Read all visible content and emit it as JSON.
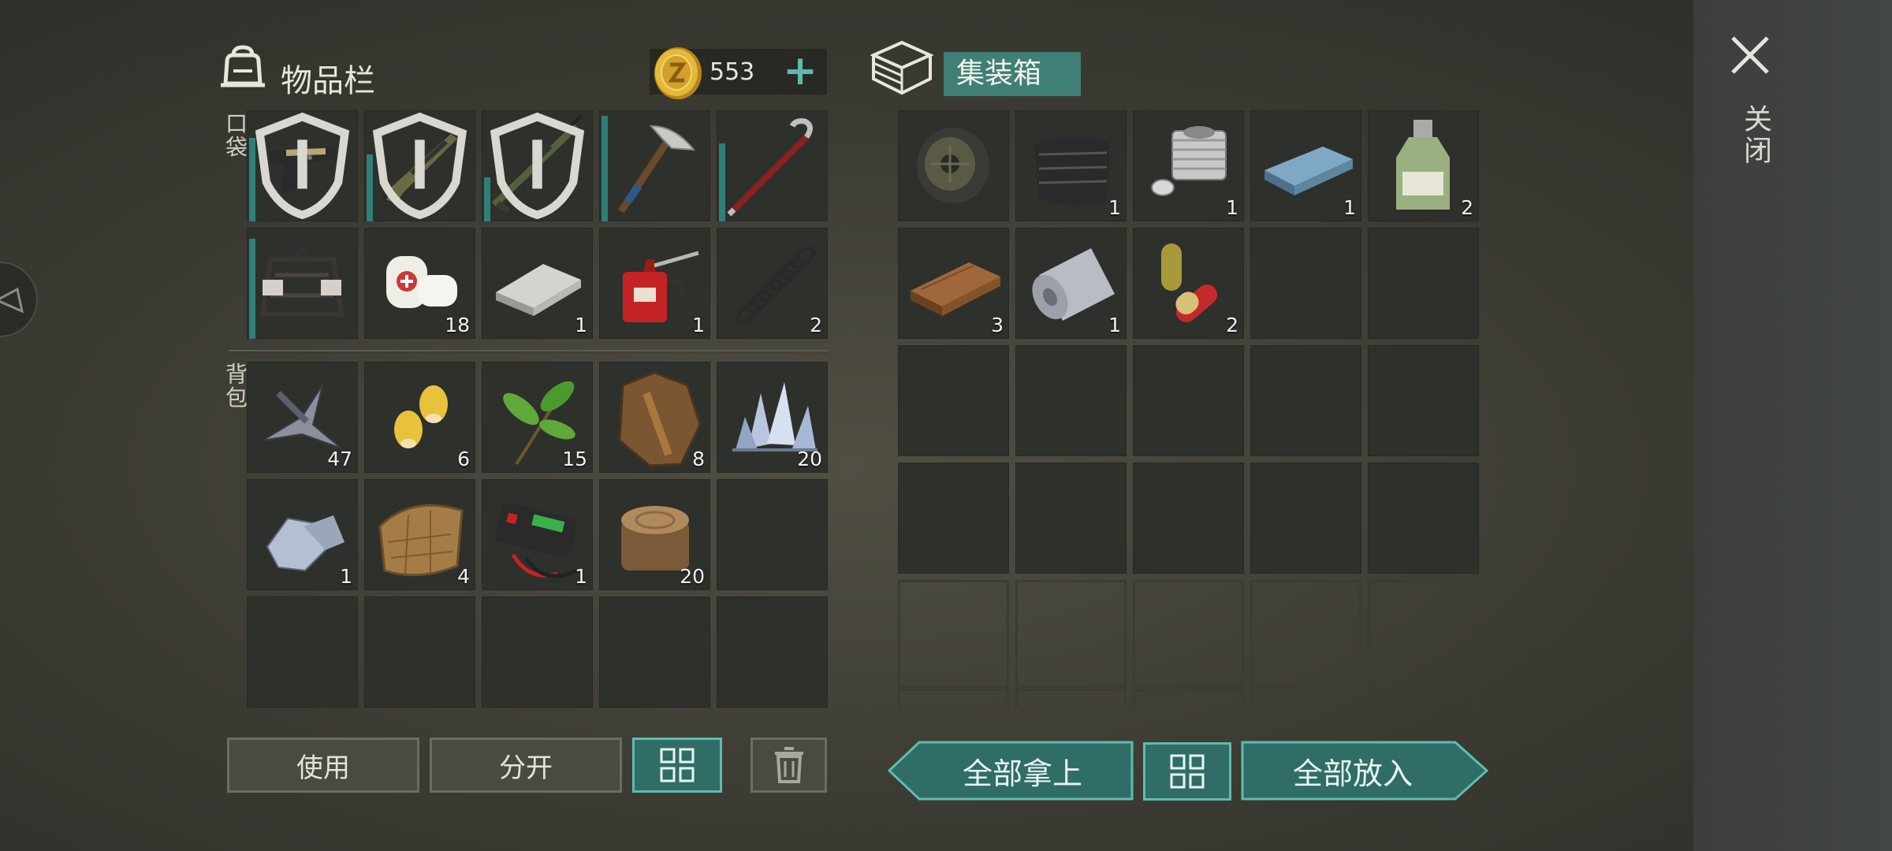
{
  "inventory": {
    "title": "物品栏",
    "coins": "553",
    "add_coins_label": "+",
    "pocket_label": "口袋",
    "backpack_label": "背包",
    "pockets": [
      {
        "item": "pistol",
        "qty": "",
        "durability": 0.75,
        "shield": true
      },
      {
        "item": "shotgun",
        "qty": "",
        "durability": 0.6,
        "shield": true
      },
      {
        "item": "sniper-rifle",
        "qty": "",
        "durability": 0.4,
        "shield": true
      },
      {
        "item": "pickaxe",
        "qty": "",
        "durability": 0.95,
        "shield": false
      },
      {
        "item": "crowbar",
        "qty": "",
        "durability": 0.7,
        "shield": false
      },
      {
        "item": "barbed-armor",
        "qty": "",
        "durability": 0.9,
        "shield": false
      },
      {
        "item": "bandage",
        "qty": "18"
      },
      {
        "item": "metal-bar",
        "qty": "1"
      },
      {
        "item": "oil-can",
        "qty": "1"
      },
      {
        "item": "spring",
        "qty": "2"
      }
    ],
    "backpack": [
      {
        "item": "scrap-metal",
        "qty": "47"
      },
      {
        "item": "corn-seeds",
        "qty": "6"
      },
      {
        "item": "plant-fiber",
        "qty": "15"
      },
      {
        "item": "animal-hide",
        "qty": "8"
      },
      {
        "item": "crystal",
        "qty": "20"
      },
      {
        "item": "iron-ore",
        "qty": "1"
      },
      {
        "item": "leather",
        "qty": "4"
      },
      {
        "item": "battery-charger",
        "qty": "1"
      },
      {
        "item": "log",
        "qty": "20"
      },
      {
        "item": "",
        "qty": ""
      },
      {
        "item": "",
        "qty": ""
      },
      {
        "item": "",
        "qty": ""
      },
      {
        "item": "",
        "qty": ""
      },
      {
        "item": "",
        "qty": ""
      },
      {
        "item": "",
        "qty": ""
      }
    ],
    "buttons": {
      "use": "使用",
      "split": "分开",
      "sort_icon": "grid-icon",
      "trash_icon": "trash-icon"
    }
  },
  "container": {
    "title": "集装箱",
    "items": [
      {
        "item": "wheel",
        "qty": ""
      },
      {
        "item": "carbon-fabric",
        "qty": "1"
      },
      {
        "item": "engine-cylinder",
        "qty": "1"
      },
      {
        "item": "steel-ingot",
        "qty": "1"
      },
      {
        "item": "chemical-bottle",
        "qty": "2"
      },
      {
        "item": "wood-plank",
        "qty": "3"
      },
      {
        "item": "fabric-roll",
        "qty": "1"
      },
      {
        "item": "pills",
        "qty": "2"
      },
      {
        "item": "",
        "qty": ""
      },
      {
        "item": "",
        "qty": ""
      },
      {
        "item": "",
        "qty": ""
      },
      {
        "item": "",
        "qty": ""
      },
      {
        "item": "",
        "qty": ""
      },
      {
        "item": "",
        "qty": ""
      },
      {
        "item": "",
        "qty": ""
      },
      {
        "item": "",
        "qty": ""
      },
      {
        "item": "",
        "qty": ""
      },
      {
        "item": "",
        "qty": ""
      },
      {
        "item": "",
        "qty": ""
      },
      {
        "item": "",
        "qty": ""
      }
    ],
    "locked_rows": 2,
    "buttons": {
      "take_all": "全部拿上",
      "put_all": "全部放入",
      "sort_icon": "grid-icon"
    }
  },
  "close_label": "关闭",
  "colors": {
    "accent": "#3f7f76",
    "accent_border": "#5fbcb0",
    "slot": "#2e302c",
    "durability": "#2f7f78"
  }
}
